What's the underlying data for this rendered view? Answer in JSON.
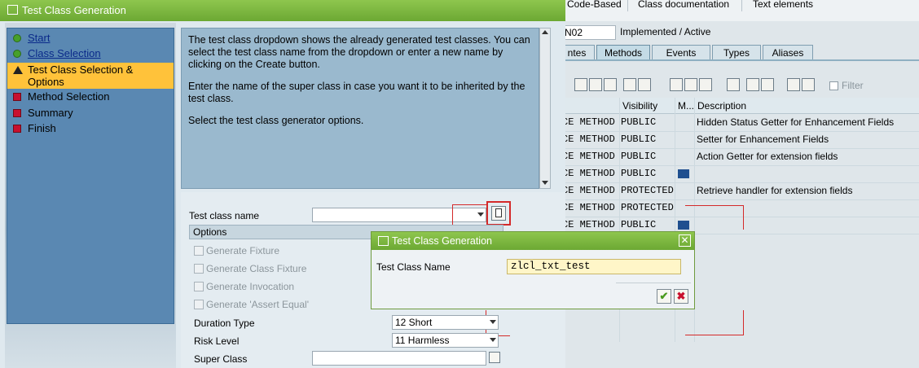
{
  "window_title": "Test Class Generation",
  "background": {
    "toolbar": [
      "Code-Based",
      "Class documentation",
      "Text elements"
    ],
    "class_field": "N02",
    "status": "Implemented / Active",
    "tabs": [
      "ntes",
      "Methods",
      "Events",
      "Types",
      "Aliases"
    ],
    "active_tab": "Methods",
    "filter_label": "Filter",
    "columns": [
      "Visibility",
      "M...",
      "Description"
    ],
    "rows": [
      {
        "type": "CE METHOD",
        "visibility": "PUBLIC",
        "description": "Hidden Status Getter for Enhancement Fields"
      },
      {
        "type": "CE METHOD",
        "visibility": "PUBLIC",
        "description": "Setter for Enhancement Fields"
      },
      {
        "type": "CE METHOD",
        "visibility": "PUBLIC",
        "description": "Action Getter for extension fields"
      },
      {
        "type": "CE METHOD",
        "visibility": "PUBLIC",
        "description": ""
      },
      {
        "type": "CE METHOD",
        "visibility": "PROTECTED",
        "description": "Retrieve handler for extension fields"
      },
      {
        "type": "CE METHOD",
        "visibility": "PROTECTED",
        "description": ""
      },
      {
        "type": "CE METHOD",
        "visibility": "PUBLIC",
        "description": ""
      }
    ]
  },
  "wizard": {
    "steps": [
      {
        "label": "Start",
        "status": "done"
      },
      {
        "label": "Class Selection",
        "status": "done"
      },
      {
        "label": "Test Class Selection & Options",
        "status": "current"
      },
      {
        "label": "Method Selection",
        "status": "todo"
      },
      {
        "label": "Summary",
        "status": "todo"
      },
      {
        "label": "Finish",
        "status": "todo"
      }
    ],
    "description": [
      "The test class dropdown shows the already generated test classes. You can select the test class name from the dropdown or enter a new name by clicking on the Create button.",
      "Enter the name of the super class in case you want it to be inherited by the test class.",
      "Select the test class generator options."
    ],
    "test_class_label": "Test class name",
    "test_class_value": "",
    "options_label": "Options",
    "options": [
      "Generate Fixture",
      "Generate Class Fixture",
      "Generate Invocation",
      "Generate 'Assert Equal'"
    ],
    "duration_label": "Duration Type",
    "duration_value": "12 Short",
    "risk_label": "Risk Level",
    "risk_value": "11 Harmless",
    "super_label": "Super Class",
    "super_value": ""
  },
  "popup": {
    "title": "Test Class Generation",
    "field_label": "Test Class Name",
    "field_value": "zlcl_txt_test",
    "close_glyph": "✕",
    "ok_glyph": "✔",
    "cancel_glyph": "✖"
  },
  "colors": {
    "title_green": "#7ab83e",
    "highlight": "#ffc23a",
    "annotation_red": "#d42a2a"
  }
}
